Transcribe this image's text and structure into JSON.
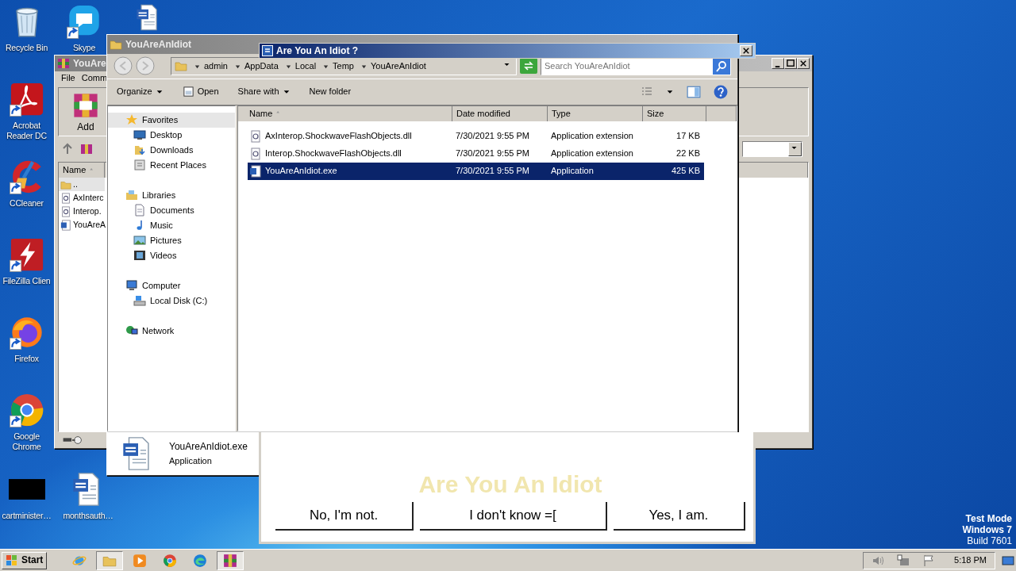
{
  "desktop_icons": [
    {
      "label": "Recycle Bin",
      "kind": "recycle-bin",
      "shortcut": false
    },
    {
      "label": "Skype",
      "kind": "chat",
      "shortcut": true
    },
    {
      "kind": "document",
      "shortcut": false
    },
    {
      "label": "Acrobat Reader DC",
      "kind": "pdf",
      "shortcut": true
    },
    {
      "label": "CCleaner",
      "kind": "cleaner",
      "shortcut": true
    },
    {
      "label": "FileZilla Clien",
      "kind": "ftp",
      "shortcut": true
    },
    {
      "label": "Firefox",
      "kind": "firefox",
      "shortcut": true
    },
    {
      "label": "Google Chrome",
      "kind": "chrome",
      "shortcut": true
    },
    {
      "label": "cartminister…",
      "kind": "thumbnail",
      "shortcut": false
    },
    {
      "label": "monthsauth…",
      "kind": "document",
      "shortcut": false
    }
  ],
  "archiver_window": {
    "title": "YouAre",
    "menu": [
      "File",
      "Comm"
    ],
    "toolbar": [
      "Add"
    ],
    "column": {
      "label": "Name",
      "sorted": true
    },
    "rows": [
      {
        "name": "..",
        "kind": "folder",
        "selected": true
      },
      {
        "name": "AxInterc",
        "kind": "dll",
        "selected": false
      },
      {
        "name": "Interop.",
        "kind": "dll",
        "selected": false
      },
      {
        "name": "YouAreA",
        "kind": "exe",
        "selected": false
      }
    ]
  },
  "explorer_window": {
    "title": "YouAreAnIdiot",
    "breadcrumbs": [
      "admin",
      "AppData",
      "Local",
      "Temp",
      "YouAreAnIdiot"
    ],
    "search": {
      "placeholder": "Search YouAreAnIdiot"
    },
    "toolbar": [
      {
        "label": "Organize",
        "kind": "menu"
      },
      {
        "label": "Open",
        "kind": "open"
      },
      {
        "label": "Share with",
        "kind": "menu"
      },
      {
        "label": "New folder",
        "kind": "command"
      }
    ],
    "nav": [
      {
        "label": "Favorites",
        "kind": "favorites",
        "selected": true,
        "children": [
          {
            "label": "Desktop",
            "kind": "desktop",
            "selected": false
          },
          {
            "label": "Downloads",
            "kind": "downloads",
            "selected": false
          },
          {
            "label": "Recent Places",
            "kind": "recent",
            "selected": false
          }
        ]
      },
      {
        "label": "Libraries",
        "kind": "libraries",
        "selected": false,
        "children": [
          {
            "label": "Documents",
            "kind": "documents",
            "selected": false
          },
          {
            "label": "Music",
            "kind": "music",
            "selected": false
          },
          {
            "label": "Pictures",
            "kind": "pictures",
            "selected": false
          },
          {
            "label": "Videos",
            "kind": "videos",
            "selected": false
          }
        ]
      },
      {
        "label": "Computer",
        "kind": "computer",
        "selected": false,
        "children": [
          {
            "label": "Local Disk (C:)",
            "kind": "disk",
            "selected": false
          }
        ]
      },
      {
        "label": "Network",
        "kind": "network",
        "selected": false
      }
    ],
    "columns": [
      {
        "label": "Name",
        "sorted": true
      },
      {
        "label": "Date modified",
        "sorted": false
      },
      {
        "label": "Type",
        "sorted": false
      },
      {
        "label": "Size",
        "sorted": false
      }
    ],
    "files": [
      {
        "name": "AxInterop.ShockwaveFlashObjects.dll",
        "date": "7/30/2021 9:55 PM",
        "type": "Application extension",
        "size": "17 KB",
        "kind": "dll",
        "selected": false
      },
      {
        "name": "Interop.ShockwaveFlashObjects.dll",
        "date": "7/30/2021 9:55 PM",
        "type": "Application extension",
        "size": "22 KB",
        "kind": "dll",
        "selected": false
      },
      {
        "name": "YouAreAnIdiot.exe",
        "date": "7/30/2021 9:55 PM",
        "type": "Application",
        "size": "425 KB",
        "kind": "exe",
        "selected": true
      }
    ],
    "details": {
      "name": "YouAreAnIdiot.exe",
      "type": "Application"
    }
  },
  "dialog": {
    "title": "Are You An Idiot ?",
    "heading": "Are You An Idiot",
    "buttons": [
      "No, I'm not.",
      "I don't know =[",
      "Yes, I am."
    ]
  },
  "os_notice": [
    {
      "text": "Test Mode",
      "bold": true
    },
    {
      "text": "Windows 7",
      "bold": true
    },
    {
      "text": "Build 7601",
      "bold": false
    }
  ],
  "taskbar": {
    "start": "Start",
    "apps": [
      {
        "kind": "ie",
        "active": false
      },
      {
        "kind": "explorer",
        "active": true
      },
      {
        "kind": "media",
        "active": false
      },
      {
        "kind": "chrome",
        "active": false
      },
      {
        "kind": "edge",
        "active": false
      },
      {
        "kind": "winrar",
        "active": true
      }
    ],
    "time": "5:18 PM"
  }
}
